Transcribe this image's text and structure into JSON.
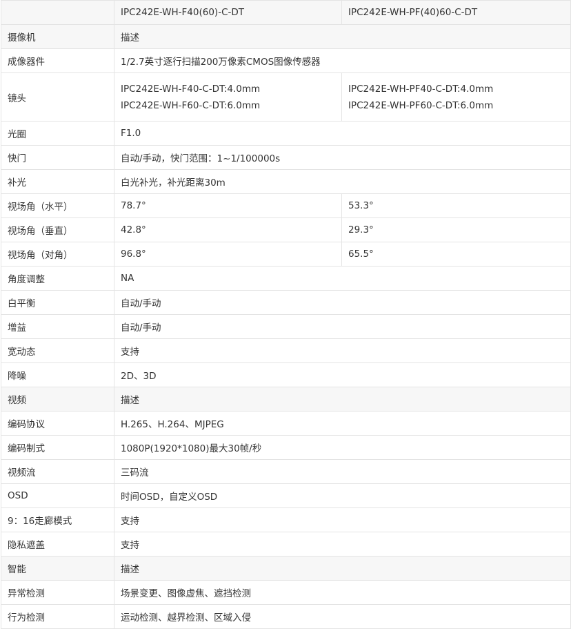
{
  "header": {
    "blank": "",
    "model_a": "IPC242E-WH-F40(60)-C-DT",
    "model_b": "IPC242E-WH-PF(40)60-C-DT"
  },
  "sections": {
    "camera": {
      "label": "摄像机",
      "desc": "描述"
    },
    "video": {
      "label": "视频",
      "desc": "描述"
    },
    "smart": {
      "label": "智能",
      "desc": "描述"
    }
  },
  "camera_rows": {
    "sensor": {
      "label": "成像器件",
      "value": "1/2.7英寸逐行扫描200万像素CMOS图像传感器"
    },
    "lens": {
      "label": "镜头",
      "a_line1": "IPC242E-WH-F40-C-DT:4.0mm",
      "a_line2": "IPC242E-WH-F60-C-DT:6.0mm",
      "b_line1": "IPC242E-WH-PF40-C-DT:4.0mm",
      "b_line2": "IPC242E-WH-PF60-C-DT:6.0mm"
    },
    "aperture": {
      "label": "光圈",
      "value": "F1.0"
    },
    "shutter": {
      "label": "快门",
      "value": "自动/手动，快门范围：1~1/100000s"
    },
    "fill_light": {
      "label": "补光",
      "value": "白光补光，补光距离30m"
    },
    "fov_h": {
      "label": "视场角（水平）",
      "a": "78.7°",
      "b": "53.3°"
    },
    "fov_v": {
      "label": "视场角（垂直）",
      "a": "42.8°",
      "b": "29.3°"
    },
    "fov_d": {
      "label": "视场角（对角）",
      "a": "96.8°",
      "b": "65.5°"
    },
    "angle_adjust": {
      "label": "角度调整",
      "value": "NA"
    },
    "white_balance": {
      "label": "白平衡",
      "value": "自动/手动"
    },
    "gain": {
      "label": "增益",
      "value": "自动/手动"
    },
    "wdr": {
      "label": "宽动态",
      "value": "支持"
    },
    "noise_reduction": {
      "label": "降噪",
      "value": "2D、3D"
    }
  },
  "video_rows": {
    "codec": {
      "label": "编码协议",
      "value": "H.265、H.264、MJPEG"
    },
    "format": {
      "label": "编码制式",
      "value": "1080P(1920*1080)最大30帧/秒"
    },
    "streams": {
      "label": "视频流",
      "value": "三码流"
    },
    "osd": {
      "label": "OSD",
      "value": "时间OSD，自定义OSD"
    },
    "corridor": {
      "label": "9：16走廊模式",
      "value": "支持"
    },
    "privacy": {
      "label": "隐私遮盖",
      "value": "支持"
    }
  },
  "smart_rows": {
    "anomaly": {
      "label": "异常检测",
      "value": "场景变更、图像虚焦、遮挡检测"
    },
    "behavior": {
      "label": "行为检测",
      "value": "运动检测、越界检测、区域入侵"
    }
  }
}
